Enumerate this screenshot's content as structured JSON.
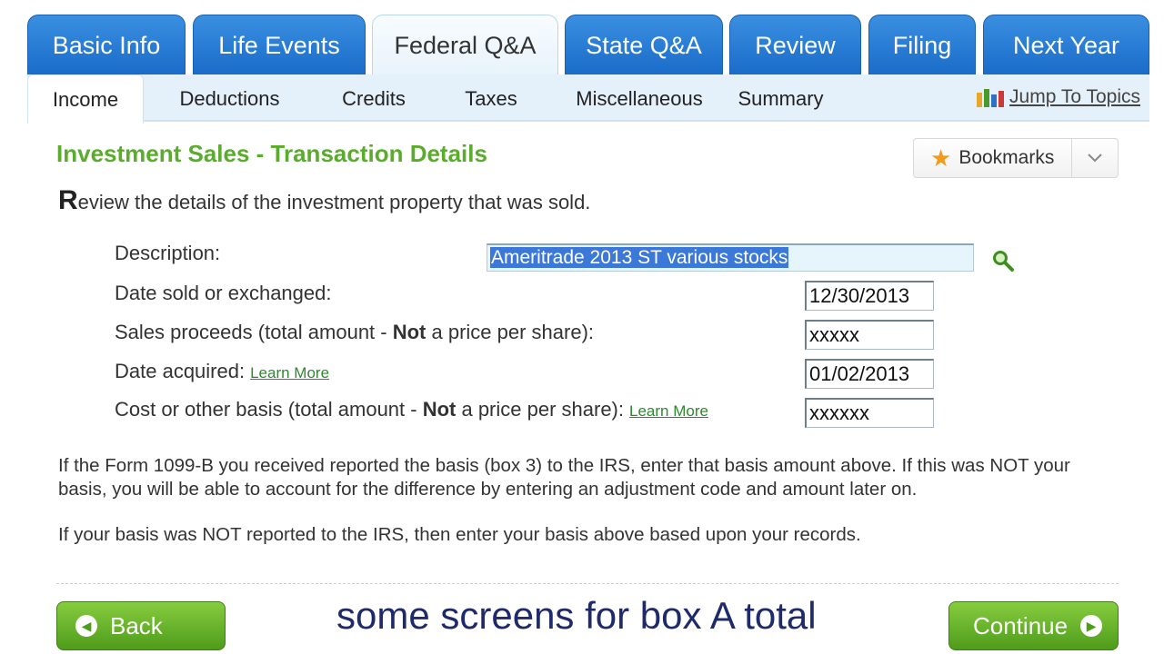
{
  "main_tabs": [
    {
      "label": "Basic Info",
      "active": false
    },
    {
      "label": "Life Events",
      "active": false
    },
    {
      "label": "Federal Q&A",
      "active": true
    },
    {
      "label": "State Q&A",
      "active": false
    },
    {
      "label": "Review",
      "active": false
    },
    {
      "label": "Filing",
      "active": false
    },
    {
      "label": "Next Year",
      "active": false
    }
  ],
  "sub_tabs": [
    {
      "label": "Income",
      "active": true
    },
    {
      "label": "Deductions",
      "active": false
    },
    {
      "label": "Credits",
      "active": false
    },
    {
      "label": "Taxes",
      "active": false
    },
    {
      "label": "Miscellaneous",
      "active": false
    },
    {
      "label": "Summary",
      "active": false
    }
  ],
  "jump_to_topics": "Jump To Topics",
  "page_title": "Investment Sales - Transaction Details",
  "bookmarks_label": "Bookmarks",
  "intro": {
    "first_letter": "R",
    "rest": "eview the details of the investment property that was sold."
  },
  "fields": {
    "description": {
      "label": "Description:",
      "value": "Ameritrade 2013 ST various stocks"
    },
    "date_sold": {
      "label": "Date sold or exchanged:",
      "value": "12/30/2013"
    },
    "sales_proceeds": {
      "label_pre": "Sales proceeds (total amount - ",
      "label_bold": "Not",
      "label_post": " a price per share):",
      "value": "xxxxx"
    },
    "date_acquired": {
      "label": "Date acquired:",
      "learn_more": "Learn More",
      "value": "01/02/2013"
    },
    "cost_basis": {
      "label_pre": "Cost or other basis (total amount - ",
      "label_bold": "Not",
      "label_post": " a price per share):",
      "learn_more": "Learn More",
      "value": "xxxxxx"
    }
  },
  "paragraph1": "If the Form 1099-B you received reported the basis (box 3) to the IRS, enter that basis amount above. If this was NOT your basis, you will be able to account for the difference by entering an adjustment code and amount later on.",
  "paragraph2": "If your basis was NOT reported to the IRS, then enter your basis above based upon your records.",
  "back_label": "Back",
  "continue_label": "Continue",
  "caption": "some screens for box A total",
  "colors": {
    "tab_blue": "#1a6cc9",
    "title_green": "#5aac2c",
    "button_green": "#4f9c1b",
    "caption_navy": "#1f2a6b"
  }
}
